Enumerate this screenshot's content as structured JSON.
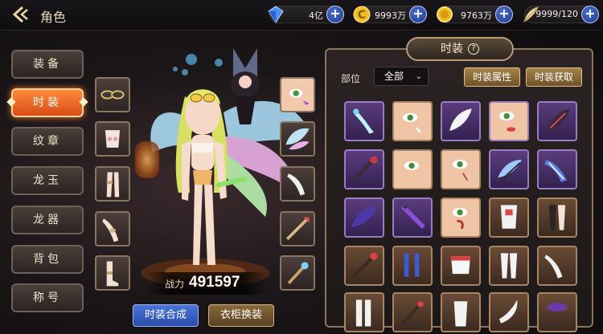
{
  "header": {
    "title": "角色",
    "resources": [
      {
        "name": "diamond",
        "value": "4亿",
        "icon": "blue-diamond-icon"
      },
      {
        "name": "gold-c",
        "value": "9993万",
        "icon": "gold-c-coin-icon"
      },
      {
        "name": "gold-coin",
        "value": "9763万",
        "icon": "gold-coin-icon"
      },
      {
        "name": "stamina",
        "value": "9999/120",
        "icon": "wing-feather-icon"
      }
    ]
  },
  "menu": {
    "items": [
      {
        "label": "装备",
        "active": false
      },
      {
        "label": "时装",
        "active": true
      },
      {
        "label": "纹章",
        "active": false
      },
      {
        "label": "龙玉",
        "active": false
      },
      {
        "label": "龙器",
        "active": false
      },
      {
        "label": "背包",
        "active": false
      },
      {
        "label": "称号",
        "active": false
      }
    ]
  },
  "character": {
    "power_label": "战力",
    "power_value": "491597"
  },
  "bottom_buttons": {
    "synthesize": "时装合成",
    "wardrobe": "衣柜换装"
  },
  "panel": {
    "tab_title": "时装",
    "help": "?",
    "part_label": "部位",
    "part_value": "全部",
    "attr_button": "时装属性",
    "get_button": "时装获取"
  },
  "colors": {
    "accent_orange": "#e8601f",
    "panel_border": "#8c7558",
    "purple_rarity": "#5b3d7e",
    "brown_rarity": "#6a4b35"
  }
}
